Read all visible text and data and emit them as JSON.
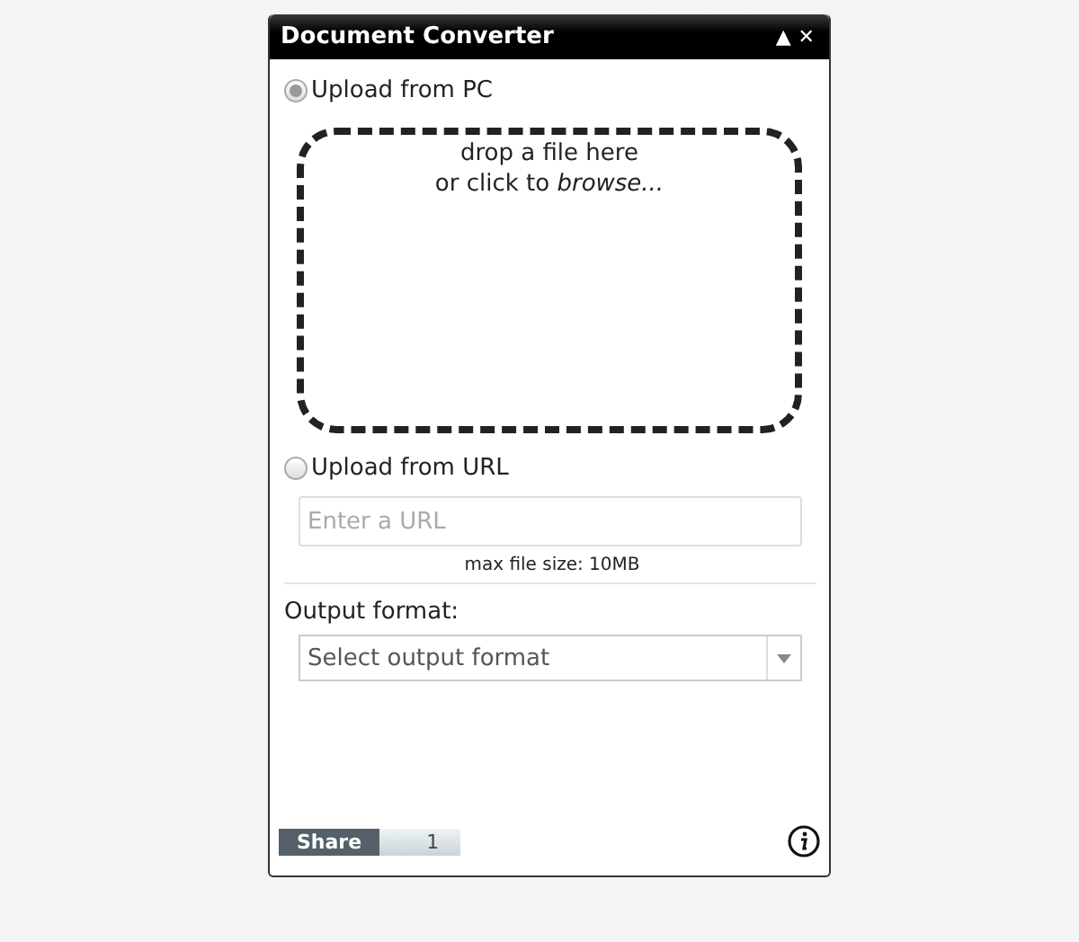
{
  "window": {
    "title": "Document Converter",
    "buttons": [
      "▲",
      "✕"
    ]
  },
  "sources": [
    {
      "label": "Upload from PC",
      "selected": true
    },
    {
      "label": "Upload from URL",
      "selected": false
    }
  ],
  "drop_zone": {
    "text": "drop a file here\nor click to *browse...*"
  },
  "url_field": {
    "placeholder": "Enter a URL"
  },
  "max_size": "max file size: 10MB",
  "output": {
    "label": "Output format:",
    "placeholder": "Select output format"
  },
  "share": {
    "label": "Share",
    "count": "1"
  }
}
